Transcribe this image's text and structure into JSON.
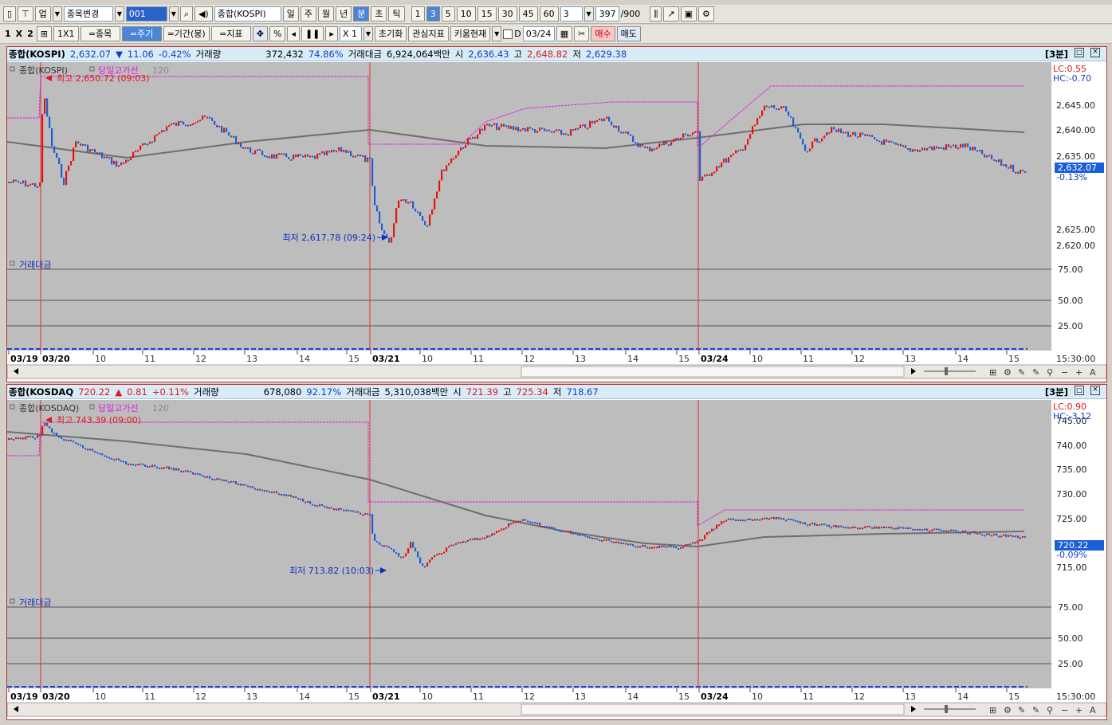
{
  "toolbar1": {
    "market": "업",
    "code_combo": "종목변경",
    "code_value": "001",
    "name_value": "종합(KOSPI)",
    "periods": [
      "일",
      "주",
      "월",
      "년",
      "분",
      "초",
      "틱"
    ],
    "selected_period": "분",
    "intervals": [
      "1",
      "3",
      "5",
      "10",
      "15",
      "30",
      "45",
      "60"
    ],
    "selected_interval": "3",
    "interval_value": "3",
    "count": "397",
    "count_max": "/900"
  },
  "toolbar2": {
    "layout": [
      "1",
      "X",
      "2"
    ],
    "btn_1x1": "1X1",
    "btn_stock": "=종목",
    "btn_period": "=주기",
    "btn_range": "=기간(봉)",
    "btn_indicator": "=지표",
    "pct": "%",
    "zoom": "X 1",
    "btn_reset": "초기화",
    "btn_watch": "관심지표",
    "btn_kiwoom": "키움현재",
    "date_check": "D",
    "date_value": "03/24",
    "btn_buy": "매수",
    "btn_sell": "매도"
  },
  "panels": [
    {
      "title": "종합(KOSPI)",
      "price": "2,632.07",
      "change_arrow": "▼",
      "change": "11.06",
      "change_pct": "-0.42%",
      "vol_label": "거래량",
      "volume": "372,432",
      "vol_ratio": "74.86%",
      "amt_label": "거래대금",
      "amount": "6,924,064백만",
      "open_label": "시",
      "open": "2,636.43",
      "high_label": "고",
      "high": "2,648.82",
      "low_label": "저",
      "low": "2,629.38",
      "badge": "[3분]",
      "legend_name": "종합(KOSPI)",
      "legend_line": "당일고가선",
      "legend_ma": "120",
      "lc": "LC:0.55",
      "hc": "HC:-0.70",
      "hi_note": "최고 2,650.72 (09:03)",
      "lo_note": "최저 2,617.78 (09:24)",
      "last_price": "2,632.07",
      "last_pct": "-0.13%",
      "yticks": [
        "2,645.00",
        "2,640.00",
        "2,635.00",
        "2,625.00",
        "2,620.00"
      ],
      "sub_label": "거래대금",
      "sub_ticks": [
        "75.00",
        "50.00",
        "25.00"
      ],
      "xticks": [
        "03/19",
        "03/20",
        "10",
        "11",
        "12",
        "13",
        "14",
        "15",
        "03/21",
        "10",
        "11",
        "12",
        "13",
        "14",
        "15",
        "03/24",
        "10",
        "11",
        "12",
        "13",
        "14",
        "15"
      ],
      "time_label": "15:30:00"
    },
    {
      "title": "종합(KOSDAQ",
      "price": "720.22",
      "change_arrow": "▲",
      "change": "0.81",
      "change_pct": "+0.11%",
      "vol_label": "거래량",
      "volume": "678,080",
      "vol_ratio": "92.17%",
      "amt_label": "거래대금",
      "amount": "5,310,038백만",
      "open_label": "시",
      "open": "721.39",
      "high_label": "고",
      "high": "725.34",
      "low_label": "저",
      "low": "718.67",
      "badge": "[3분]",
      "legend_name": "종합(KOSDAQ)",
      "legend_line": "당일고가선",
      "legend_ma": "120",
      "lc": "LC:0.90",
      "hc": "HC:-3.12",
      "hi_note": "최고 743.39 (09:00)",
      "lo_note": "최저 713.82 (10:03)",
      "last_price": "720.22",
      "last_pct": "-0.09%",
      "yticks": [
        "740.00",
        "735.00",
        "730.00",
        "725.00",
        "715.00"
      ],
      "yticks_extra": "745.00",
      "sub_label": "거래대금",
      "sub_ticks": [
        "75.00",
        "50.00",
        "25.00"
      ],
      "xticks": [
        "03/19",
        "03/20",
        "10",
        "11",
        "12",
        "13",
        "14",
        "15",
        "03/21",
        "10",
        "11",
        "12",
        "13",
        "14",
        "15",
        "03/24",
        "10",
        "11",
        "12",
        "13",
        "14",
        "15"
      ],
      "time_label": "15:30:00"
    }
  ],
  "colors": {
    "up": "#e81010",
    "down": "#1a5fd8",
    "hiline": "#e020e0",
    "ma": "#707070",
    "accent": "#d02020"
  }
}
